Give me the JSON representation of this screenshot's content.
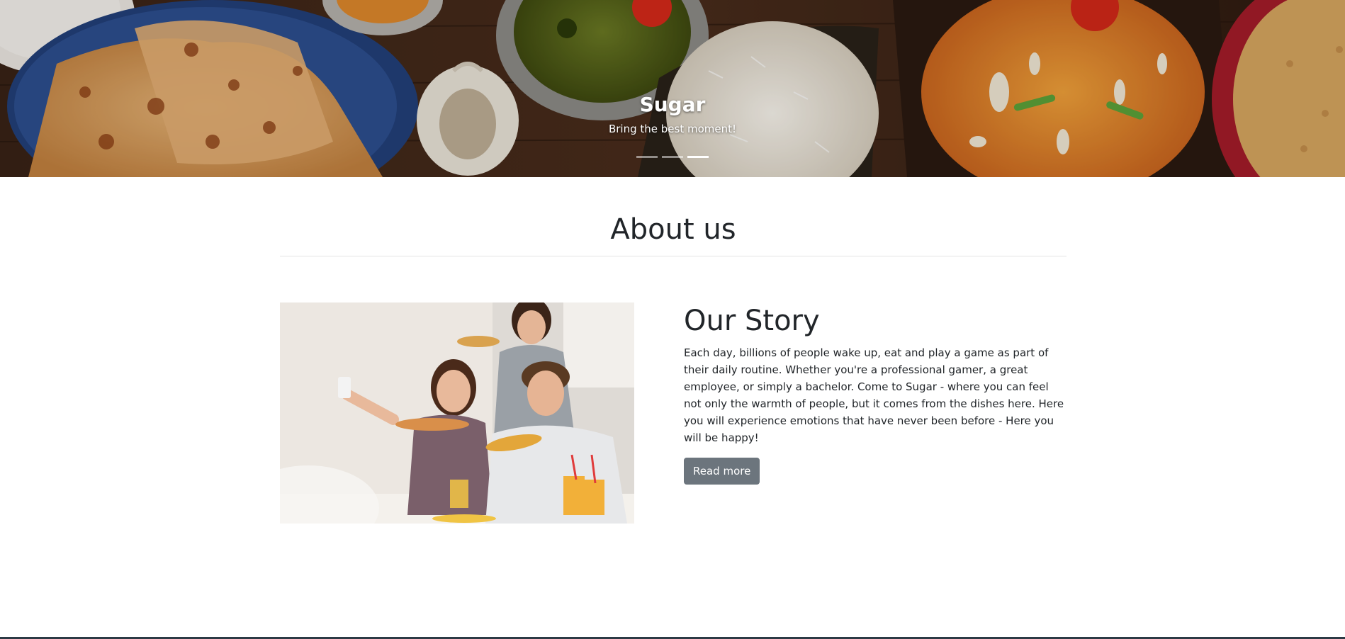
{
  "hero": {
    "title": "Sugar",
    "subtitle": "Bring the best moment!",
    "slides": [
      {
        "label": "Slide 1",
        "active": false
      },
      {
        "label": "Slide 2",
        "active": false
      },
      {
        "label": "Slide 3",
        "active": true
      }
    ]
  },
  "about": {
    "heading": "About us"
  },
  "story": {
    "heading": "Our Story",
    "body": "Each day, billions of people wake up, eat and play a game as part of their daily routine. Whether you're a professional gamer, a great employee, or simply a bachelor. Come to Sugar - where you can feel not only the warmth of people, but it comes from the dishes here. Here you will experience emotions that have never been before - Here you will be happy!",
    "button_label": "Read more"
  },
  "colors": {
    "button": "#6c757d",
    "text": "#212529",
    "divider": "#e3e3e3"
  }
}
